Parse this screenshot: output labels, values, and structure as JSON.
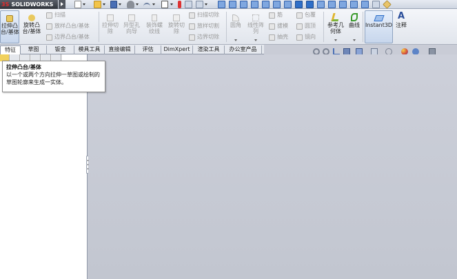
{
  "app": {
    "logo_prefix": "3S",
    "logo_text": "SOLIDWORKS"
  },
  "colors": {
    "graphics_bg": "#c6c9d3",
    "accent_blue": "#2f6fc8",
    "highlight": "#c7d6ec"
  },
  "command_manager": {
    "big_buttons": [
      {
        "label": "拉伸凸\n台/基体",
        "icon": "extrude-boss-icon"
      },
      {
        "label": "旋转凸\n台/基体",
        "icon": "revolve-boss-icon"
      },
      {
        "label": "拉伸切\n除",
        "icon": "extrude-cut-icon"
      },
      {
        "label": "异型孔\n向导",
        "icon": "hole-wizard-icon"
      },
      {
        "label": "装饰螺\n纹线",
        "icon": "cosmetic-thread-icon"
      },
      {
        "label": "旋转切\n除",
        "icon": "revolve-cut-icon"
      },
      {
        "label": "圆角",
        "icon": "fillet-icon"
      },
      {
        "label": "线性阵\n列",
        "icon": "linear-pattern-icon"
      },
      {
        "label": "参考几\n何体",
        "icon": "reference-geometry-icon"
      },
      {
        "label": "曲线",
        "icon": "curves-icon"
      },
      {
        "label": "Instant3D",
        "icon": "instant3d-icon"
      },
      {
        "label": "注释",
        "icon": "annotation-icon"
      }
    ],
    "small_buttons": {
      "sweep": "扫描",
      "loft": "放样凸台/基体",
      "boundary": "边界凸台/基体",
      "swept_cut": "扫描切除",
      "lofted_cut": "放样切割",
      "boundary_cut": "边界切除",
      "rib": "筋",
      "draft": "拔模",
      "shell": "抽壳",
      "wrap": "包覆",
      "dome": "圆顶",
      "mirror": "镜向"
    }
  },
  "tabs": [
    "特征",
    "草图",
    "钣金",
    "模具工具",
    "直接编辑",
    "评估",
    "DimXpert",
    "渲染工具",
    "办公室产品"
  ],
  "tooltip": {
    "title": "拉伸凸台/基体",
    "body": "以一个或两个方向拉伸一草图或绘制的草图轮廓来生成一实体。"
  }
}
